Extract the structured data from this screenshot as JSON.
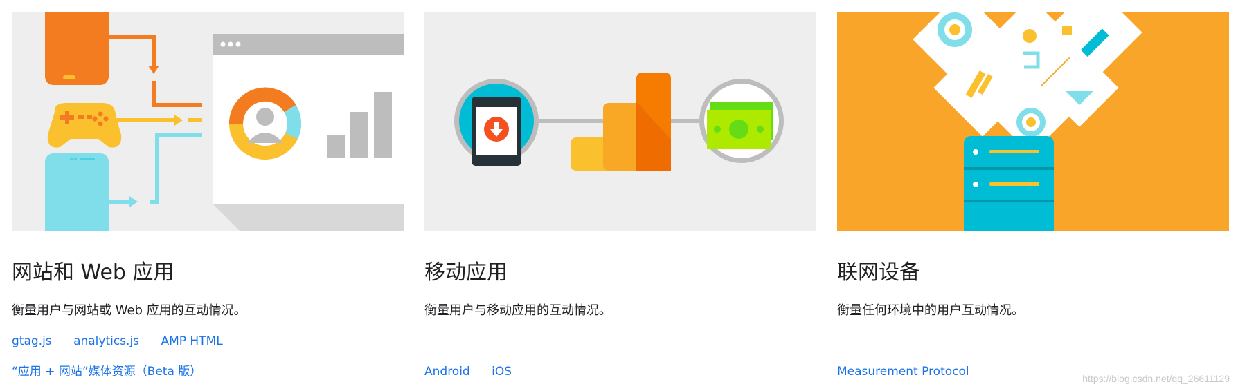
{
  "cards": [
    {
      "title": "网站和 Web 应用",
      "description": "衡量用户与网站或 Web 应用的互动情况。",
      "links": [
        "gtag.js",
        "analytics.js",
        "AMP HTML"
      ],
      "links_row2": [
        "“应用 + 网站”媒体资源（Beta 版）"
      ],
      "illustration": "websites-devices-to-browser-analytics"
    },
    {
      "title": "移动应用",
      "description": "衡量用户与移动应用的互动情况。",
      "links_row2": [
        "Android",
        "iOS"
      ],
      "illustration": "mobile-download-analytics-money"
    },
    {
      "title": "联网设备",
      "description": "衡量任何环境中的用户互动情况。",
      "links_row2": [
        "Measurement Protocol"
      ],
      "illustration": "connected-devices-server"
    }
  ],
  "watermark": "https://blog.csdn.net/qq_26611129",
  "colors": {
    "link": "#1a73e8",
    "text": "#202124",
    "orange": "#f37b20",
    "yellow": "#fbc02d",
    "cyan": "#80deea",
    "grey_bg": "#eeeeee",
    "orange_bg": "#f9a52a"
  }
}
